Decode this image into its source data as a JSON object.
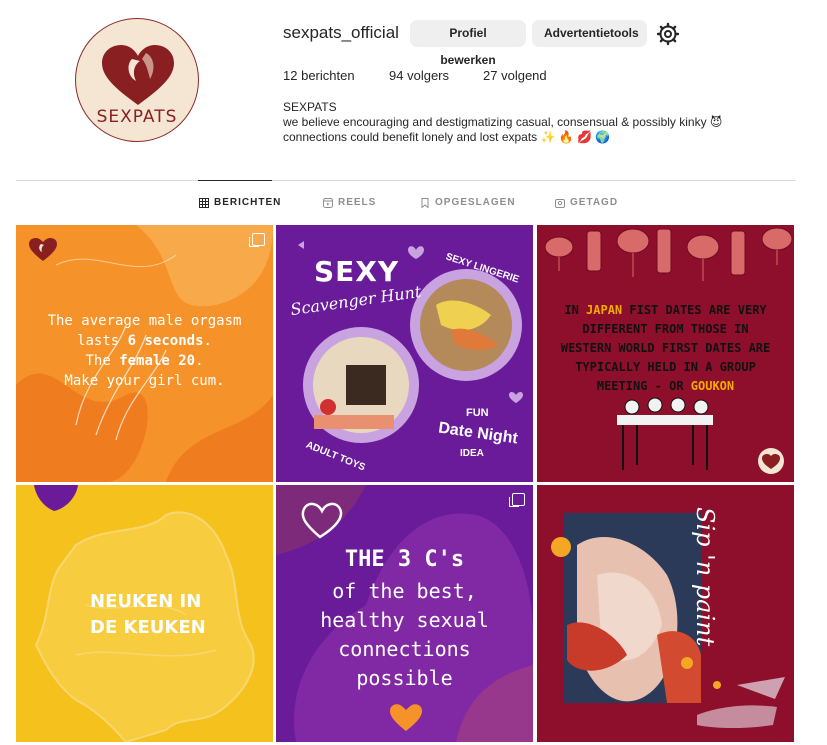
{
  "profile": {
    "username": "sexpats_official",
    "avatar_text": "SEXPATS",
    "edit_button": "Profiel bewerken",
    "ads_button": "Advertentietools",
    "settings_icon": "gear-icon"
  },
  "stats": {
    "posts_count": "12",
    "posts_label": "berichten",
    "followers_count": "94",
    "followers_label": "volgers",
    "following_count": "27",
    "following_label": "volgend"
  },
  "bio": {
    "name": "SEXPATS",
    "text": "we believe encouraging and destigmatizing casual, consensual & possibly kinky 😈 connections could benefit lonely and lost expats ✨ 🔥 💋 🌍"
  },
  "tabs": [
    {
      "label": "BERICHTEN",
      "icon": "grid-icon",
      "active": true
    },
    {
      "label": "REELS",
      "icon": "reels-icon",
      "active": false
    },
    {
      "label": "OPGESLAGEN",
      "icon": "bookmark-icon",
      "active": false
    },
    {
      "label": "GETAGD",
      "icon": "tagged-icon",
      "active": false
    }
  ],
  "posts": {
    "p1": {
      "line1": "The average male orgasm",
      "line2a": "lasts ",
      "line2b": "6 seconds",
      "line2c": ".",
      "line3a": "The ",
      "line3b": "female 20",
      "line3c": ".",
      "line4": "Make your girl cum."
    },
    "p2": {
      "title": "SEXY",
      "subtitle": "Scavenger Hunt",
      "lingerie": "SEXY LINGERIE",
      "fun": "FUN",
      "date": "Date Night",
      "idea": "IDEA",
      "toys": "ADULT TOYS"
    },
    "p3": {
      "t1": "IN ",
      "japan": "JAPAN",
      "t2": " FIST DATES ARE VERY DIFFERENT FROM THOSE IN WESTERN WORLD FIRST DATES ARE TYPICALLY HELD IN A GROUP MEETING - OR ",
      "goukon": "GOUKON",
      "logo": "SEXPATS"
    },
    "p4": {
      "line1": "NEUKEN IN",
      "line2": "DE KEUKEN"
    },
    "p5": {
      "title": "THE 3 C's",
      "l1": "of the best,",
      "l2": "healthy sexual",
      "l3": "connections",
      "l4": "possible"
    },
    "p6": {
      "text": "Sip 'n paint"
    }
  },
  "colors": {
    "brand_red": "#8a1f22",
    "orange": "#f5932a",
    "purple": "#6a1b9a",
    "crimson": "#8e0f2c",
    "yellow": "#f5c11c"
  }
}
